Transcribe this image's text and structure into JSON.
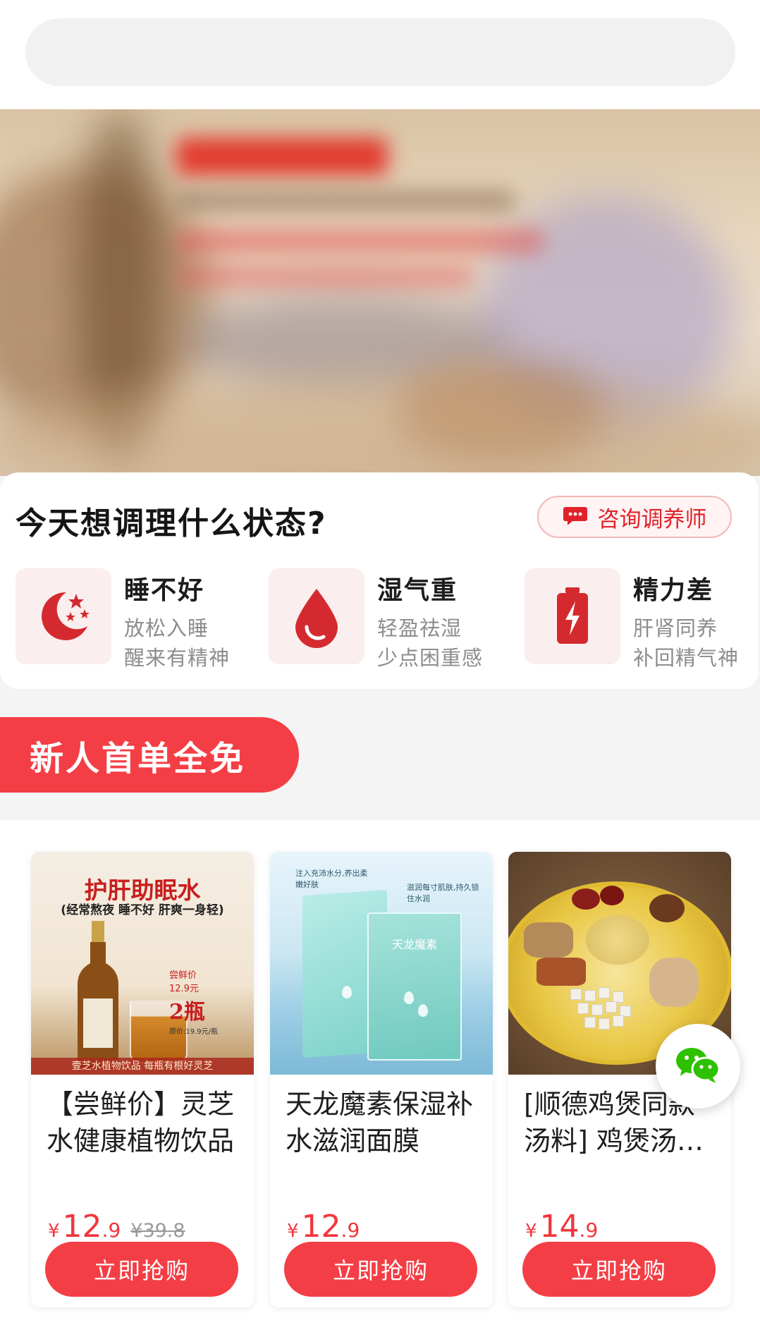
{
  "search": {
    "placeholder": ""
  },
  "state_section": {
    "title": "今天想调理什么状态?",
    "consult_label": "咨询调养师",
    "items": [
      {
        "name": "睡不好",
        "sub1": "放松入睡",
        "sub2": "醒来有精神",
        "icon": "moon-stars-icon"
      },
      {
        "name": "湿气重",
        "sub1": "轻盈祛湿",
        "sub2": "少点困重感",
        "icon": "water-drop-icon"
      },
      {
        "name": "精力差",
        "sub1": "肝肾同养",
        "sub2": "补回精气神",
        "icon": "battery-bolt-icon"
      }
    ]
  },
  "new_user": {
    "label": "新人首单全免"
  },
  "products": [
    {
      "title": "【尝鲜价】灵芝水健康植物饮品",
      "price_int": "12",
      "price_dec": ".9",
      "currency": "¥",
      "orig_price": "¥39.8",
      "buy_label": "立即抢购",
      "img_text": {
        "headline": "护肝助眠水",
        "subline": "(经常熬夜 睡不好 肝爽一身轻)",
        "promo_a": "尝鲜价",
        "promo_price": "12.9元",
        "promo_b": "2瓶",
        "promo_c": "原价:19.9元/瓶",
        "footer": "壹芝水植物饮品 每瓶有根好灵芝"
      }
    },
    {
      "title": "天龙魔素保湿补水滋润面膜",
      "price_int": "12",
      "price_dec": ".9",
      "currency": "¥",
      "orig_price": "",
      "buy_label": "立即抢购",
      "img_text": {
        "brand": "天龙魔素",
        "cap_left": "注入充沛水分,养出柔嫩好肤",
        "cap_right": "滋润每寸肌肤,持久锁住水润"
      }
    },
    {
      "title": "[顺德鸡煲同款汤料] 鸡煲汤料包",
      "price_int": "14",
      "price_dec": ".9",
      "currency": "¥",
      "orig_price": "",
      "buy_label": "立即抢购"
    }
  ],
  "colors": {
    "accent": "#f43e45",
    "price": "#f2353d",
    "muted": "#8c8c8c"
  },
  "float_button": {
    "icon": "wechat-icon"
  }
}
